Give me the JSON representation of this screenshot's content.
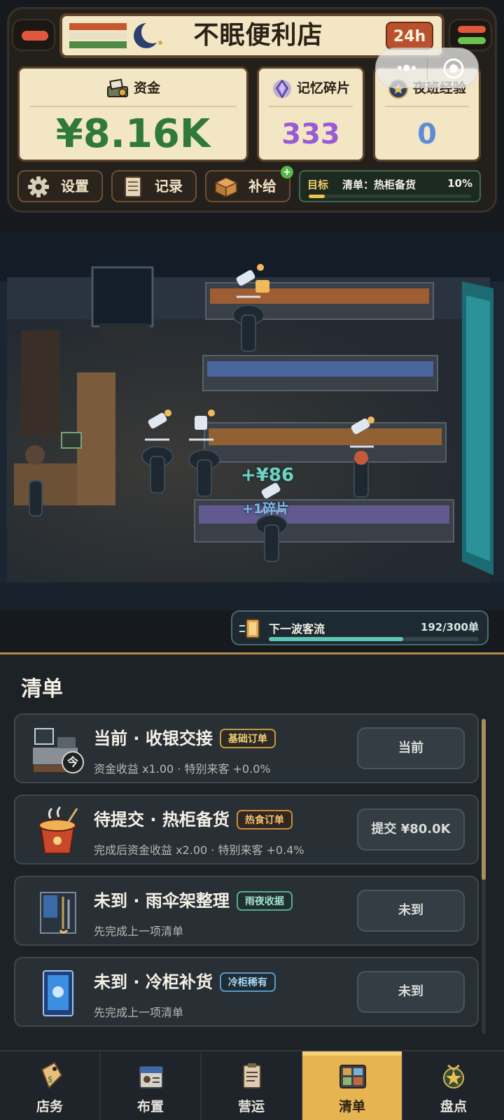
{
  "header": {
    "store_name": "不眠便利店",
    "hours_badge": "24h"
  },
  "stats": {
    "funds": {
      "label": "资金",
      "value": "¥8.16K"
    },
    "shards": {
      "label": "记忆碎片",
      "value": "333"
    },
    "exp": {
      "label": "夜班经验",
      "value": "0"
    }
  },
  "actions": {
    "settings": "设置",
    "log": "记录",
    "supply": "补给",
    "supply_badge": "+"
  },
  "goal": {
    "tag": "目标",
    "text": "清单：热柜备货",
    "percent_label": "10%",
    "progress": 0.1
  },
  "scene": {
    "float_money": "+¥86",
    "float_shard": "+1碎片"
  },
  "wave": {
    "label": "下一波客流",
    "count": "192/300单",
    "progress": 0.64
  },
  "list": {
    "title": "清单",
    "items": [
      {
        "name": "当前 · 收银交接",
        "tag": "基础订单",
        "desc": "资金收益 x1.00 · 特别来客 +0.0%",
        "action": "当前",
        "badge": "今"
      },
      {
        "name": "待提交 · 热柜备货",
        "tag": "热食订单",
        "desc": "完成后资金收益 x2.00 · 特别来客 +0.4%",
        "action": "提交 ¥80.0K"
      },
      {
        "name": "未到 · 雨伞架整理",
        "tag": "雨夜收据",
        "desc": "先完成上一项清单",
        "action": "未到"
      },
      {
        "name": "未到 · 冷柜补货",
        "tag": "冷柜稀有",
        "desc": "先完成上一项清单",
        "action": "未到"
      }
    ]
  },
  "nav": [
    {
      "label": "店务"
    },
    {
      "label": "布置"
    },
    {
      "label": "营运"
    },
    {
      "label": "清单",
      "active": true
    },
    {
      "label": "盘点"
    }
  ],
  "colors": {
    "accent_gold": "#e6b552",
    "funds_green": "#2f7a3a",
    "shard_purple": "#9a5ad6",
    "exp_blue": "#5c8cd8",
    "progress_teal": "#5ec6b3"
  }
}
